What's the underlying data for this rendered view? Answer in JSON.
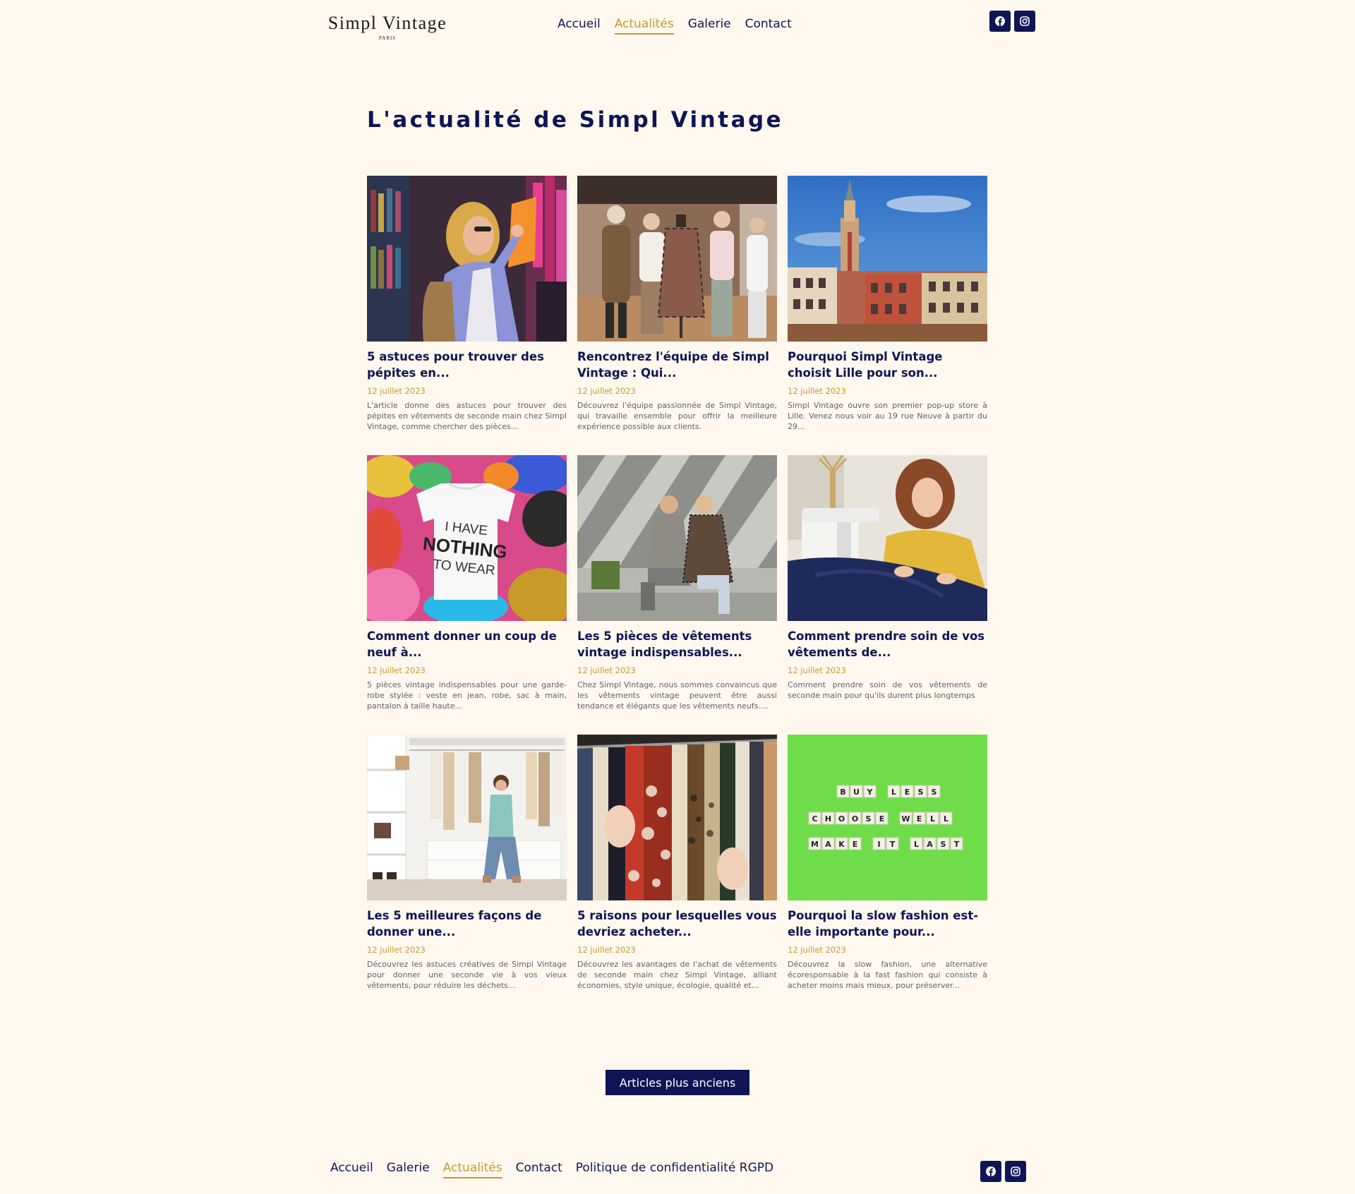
{
  "header": {
    "logo_main": "Simpl Vintage",
    "logo_sub": "PARIS",
    "nav": [
      {
        "label": "Accueil",
        "active": false
      },
      {
        "label": "Actualités",
        "active": true
      },
      {
        "label": "Galerie",
        "active": false
      },
      {
        "label": "Contact",
        "active": false
      }
    ],
    "social": [
      "facebook-icon",
      "instagram-icon"
    ]
  },
  "page_title": "L'actualité de Simpl Vintage",
  "articles": [
    {
      "title": "5 astuces pour trouver des pépites en...",
      "date": "12 juillet 2023",
      "excerpt": "L'article donne des astuces pour trouver des pépites en vêtements de seconde main chez Simpl Vintage, comme chercher des pièces..."
    },
    {
      "title": "Rencontrez l'équipe de Simpl Vintage : Qui...",
      "date": "12 juillet 2023",
      "excerpt": "Découvrez l'équipe passionnée de Simpl Vintage, qui travaille ensemble pour offrir la meilleure expérience possible aux clients."
    },
    {
      "title": "Pourquoi Simpl Vintage choisit Lille pour son...",
      "date": "12 juillet 2023",
      "excerpt": "Simpl Vintage ouvre son premier pop-up store à Lille. Venez nous voir au 19 rue Neuve à partir du 29..."
    },
    {
      "title": "Comment donner un coup de neuf à...",
      "date": "12 juillet 2023",
      "excerpt": "5 pièces vintage indispensables pour une garde-robe stylée : veste en jean, robe, sac à main, pantalon à taille haute..."
    },
    {
      "title": "Les 5 pièces de vêtements vintage indispensables...",
      "date": "12 juillet 2023",
      "excerpt": "Chez Simpl Vintage, nous sommes convaincus que les vêtements vintage peuvent être aussi tendance et élégants que les vêtements neufs...."
    },
    {
      "title": "Comment prendre soin de vos vêtements de...",
      "date": "12 juillet 2023",
      "excerpt": "Comment prendre soin de vos vêtements de seconde main pour qu'ils durent plus longtemps"
    },
    {
      "title": "Les 5 meilleures façons de donner une...",
      "date": "12 juillet 2023",
      "excerpt": "Découvrez les astuces créatives de Simpl Vintage pour donner une seconde vie à vos vieux vêtements, pour réduire les déchets..."
    },
    {
      "title": "5 raisons pour lesquelles vous devriez acheter...",
      "date": "12 juillet 2023",
      "excerpt": "Découvrez les avantages de l'achat de vêtements de seconde main chez Simpl Vintage, alliant économies, style unique, écologie, qualité et..."
    },
    {
      "title": "Pourquoi la slow fashion est-elle importante pour...",
      "date": "12 juillet 2023",
      "excerpt": "Découvrez la slow fashion, une alternative écoresponsable à la fast fashion qui consiste à acheter moins mais mieux, pour préserver..."
    }
  ],
  "images": {
    "tshirt_line1": "I HAVE",
    "tshirt_line2": "NOTHING",
    "tshirt_line3": "TO WEAR",
    "tiles_row1": [
      "B",
      "U",
      "Y",
      " ",
      "L",
      "E",
      "S",
      "S"
    ],
    "tiles_row2": [
      "C",
      "H",
      "O",
      "O",
      "S",
      "E",
      " ",
      "W",
      "E",
      "L",
      "L"
    ],
    "tiles_row3": [
      "M",
      "A",
      "K",
      "E",
      " ",
      "I",
      "T",
      " ",
      "L",
      "A",
      "S",
      "T"
    ]
  },
  "older_button": "Articles plus anciens",
  "footer": {
    "nav": [
      {
        "label": "Accueil",
        "active": false
      },
      {
        "label": "Galerie",
        "active": false
      },
      {
        "label": "Actualités",
        "active": true
      },
      {
        "label": "Contact",
        "active": false
      },
      {
        "label": "Politique de confidentialité RGPD",
        "active": false
      }
    ]
  },
  "colors": {
    "navy": "#0f1554",
    "gold": "#c59b2d",
    "background": "#fff8ef"
  }
}
